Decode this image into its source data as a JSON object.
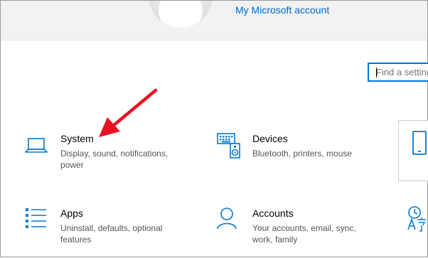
{
  "header": {
    "account_link": "My Microsoft account"
  },
  "search": {
    "placeholder": "Find a setting"
  },
  "tiles": [
    {
      "id": "system",
      "icon": "laptop-icon",
      "title": "System",
      "description": "Display, sound, notifications, power"
    },
    {
      "id": "devices",
      "icon": "keyboard-speaker-icon",
      "title": "Devices",
      "description": "Bluetooth, printers, mouse"
    },
    {
      "id": "apps",
      "icon": "app-list-icon",
      "title": "Apps",
      "description": "Uninstall, defaults, optional features"
    },
    {
      "id": "accounts",
      "icon": "person-icon",
      "title": "Accounts",
      "description": "Your accounts, email, sync, work, family"
    }
  ],
  "partial_tiles": [
    {
      "icon": "phone-icon"
    },
    {
      "icon": "time-language-icon"
    }
  ],
  "colors": {
    "accent": "#0078d7",
    "link": "#0066cc",
    "annotation_arrow": "#e81123"
  }
}
